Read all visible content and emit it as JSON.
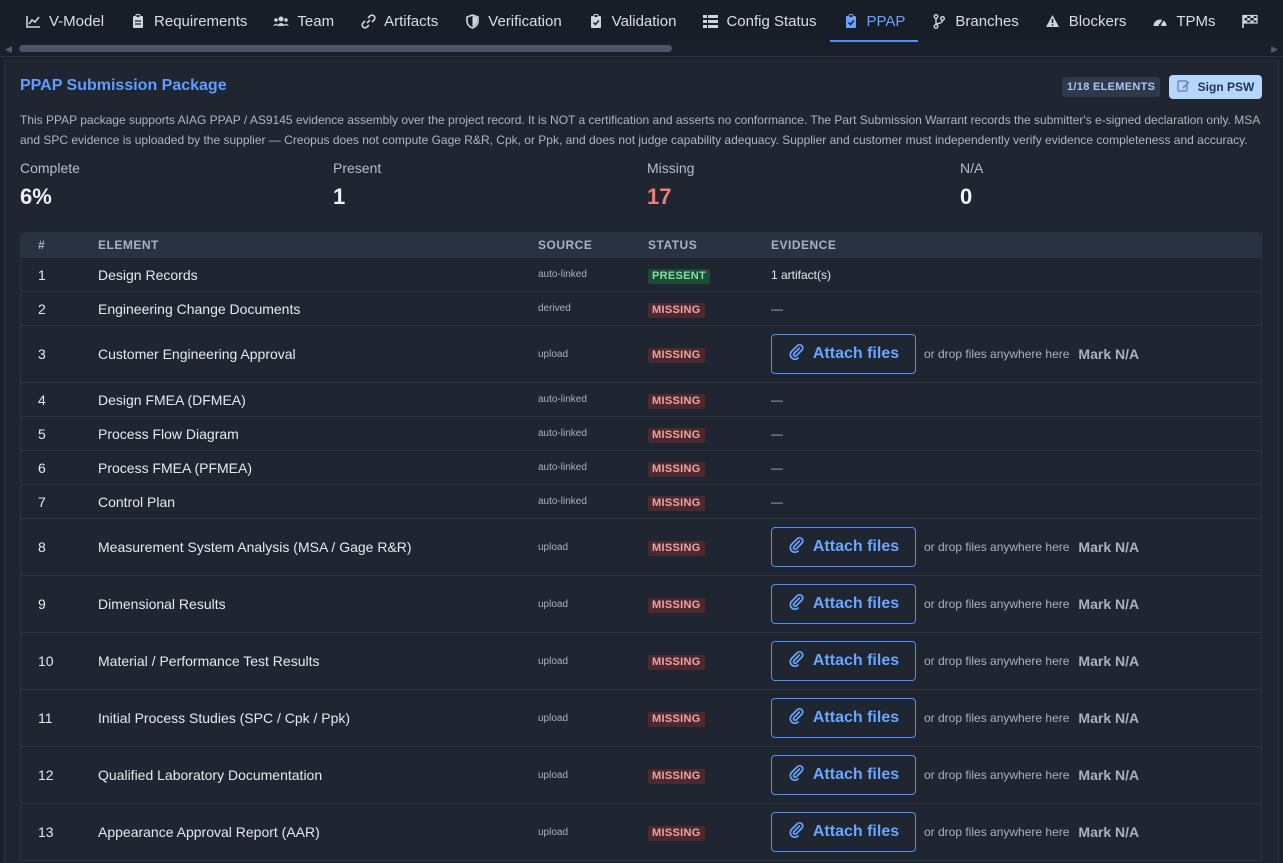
{
  "tabs": [
    {
      "label": "V-Model",
      "icon": "chart-line-icon",
      "active": false
    },
    {
      "label": "Requirements",
      "icon": "clipboard-icon",
      "active": false
    },
    {
      "label": "Team",
      "icon": "users-icon",
      "active": false
    },
    {
      "label": "Artifacts",
      "icon": "link-icon",
      "active": false
    },
    {
      "label": "Verification",
      "icon": "shield-icon",
      "active": false
    },
    {
      "label": "Validation",
      "icon": "clipboard-check-icon",
      "active": false
    },
    {
      "label": "Config Status",
      "icon": "list-icon",
      "active": false
    },
    {
      "label": "PPAP",
      "icon": "clipboard-check-icon",
      "active": true
    },
    {
      "label": "Branches",
      "icon": "branch-icon",
      "active": false
    },
    {
      "label": "Blockers",
      "icon": "warning-icon",
      "active": false
    },
    {
      "label": "TPMs",
      "icon": "gauge-icon",
      "active": false
    },
    {
      "label": "",
      "icon": "flag-checkered-icon",
      "active": false
    }
  ],
  "header": {
    "title": "PPAP Submission Package",
    "count_badge": "1/18 ELEMENTS",
    "sign_button": "Sign PSW",
    "description": "This PPAP package supports AIAG PPAP / AS9145 evidence assembly over the project record. It is NOT a certification and asserts no conformance. The Part Submission Warrant records the submitter's e-signed declaration only. MSA and SPC evidence is uploaded by the supplier — Creopus does not compute Gage R&R, Cpk, or Ppk, and does not judge capability adequacy. Supplier and customer must independently verify evidence completeness and accuracy."
  },
  "stats": [
    {
      "label": "Complete",
      "value": "6%"
    },
    {
      "label": "Present",
      "value": "1"
    },
    {
      "label": "Missing",
      "value": "17"
    },
    {
      "label": "N/A",
      "value": "0"
    }
  ],
  "table": {
    "columns": [
      "#",
      "ELEMENT",
      "SOURCE",
      "STATUS",
      "EVIDENCE"
    ],
    "attach_label": "Attach files",
    "drop_hint": "or drop files anywhere here",
    "mark_na_label": "Mark N/A",
    "rows": [
      {
        "num": "1",
        "element": "Design Records",
        "source": "auto-linked",
        "status": "PRESENT",
        "evidence": "1 artifact(s)",
        "upload": false
      },
      {
        "num": "2",
        "element": "Engineering Change Documents",
        "source": "derived",
        "status": "MISSING",
        "evidence": "—",
        "upload": false
      },
      {
        "num": "3",
        "element": "Customer Engineering Approval",
        "source": "upload",
        "status": "MISSING",
        "evidence": "",
        "upload": true
      },
      {
        "num": "4",
        "element": "Design FMEA (DFMEA)",
        "source": "auto-linked",
        "status": "MISSING",
        "evidence": "—",
        "upload": false
      },
      {
        "num": "5",
        "element": "Process Flow Diagram",
        "source": "auto-linked",
        "status": "MISSING",
        "evidence": "—",
        "upload": false
      },
      {
        "num": "6",
        "element": "Process FMEA (PFMEA)",
        "source": "auto-linked",
        "status": "MISSING",
        "evidence": "—",
        "upload": false
      },
      {
        "num": "7",
        "element": "Control Plan",
        "source": "auto-linked",
        "status": "MISSING",
        "evidence": "—",
        "upload": false
      },
      {
        "num": "8",
        "element": "Measurement System Analysis (MSA / Gage R&R)",
        "source": "upload",
        "status": "MISSING",
        "evidence": "",
        "upload": true
      },
      {
        "num": "9",
        "element": "Dimensional Results",
        "source": "upload",
        "status": "MISSING",
        "evidence": "",
        "upload": true
      },
      {
        "num": "10",
        "element": "Material / Performance Test Results",
        "source": "upload",
        "status": "MISSING",
        "evidence": "",
        "upload": true
      },
      {
        "num": "11",
        "element": "Initial Process Studies (SPC / Cpk / Ppk)",
        "source": "upload",
        "status": "MISSING",
        "evidence": "",
        "upload": true
      },
      {
        "num": "12",
        "element": "Qualified Laboratory Documentation",
        "source": "upload",
        "status": "MISSING",
        "evidence": "",
        "upload": true
      },
      {
        "num": "13",
        "element": "Appearance Approval Report (AAR)",
        "source": "upload",
        "status": "MISSING",
        "evidence": "",
        "upload": true
      }
    ]
  }
}
